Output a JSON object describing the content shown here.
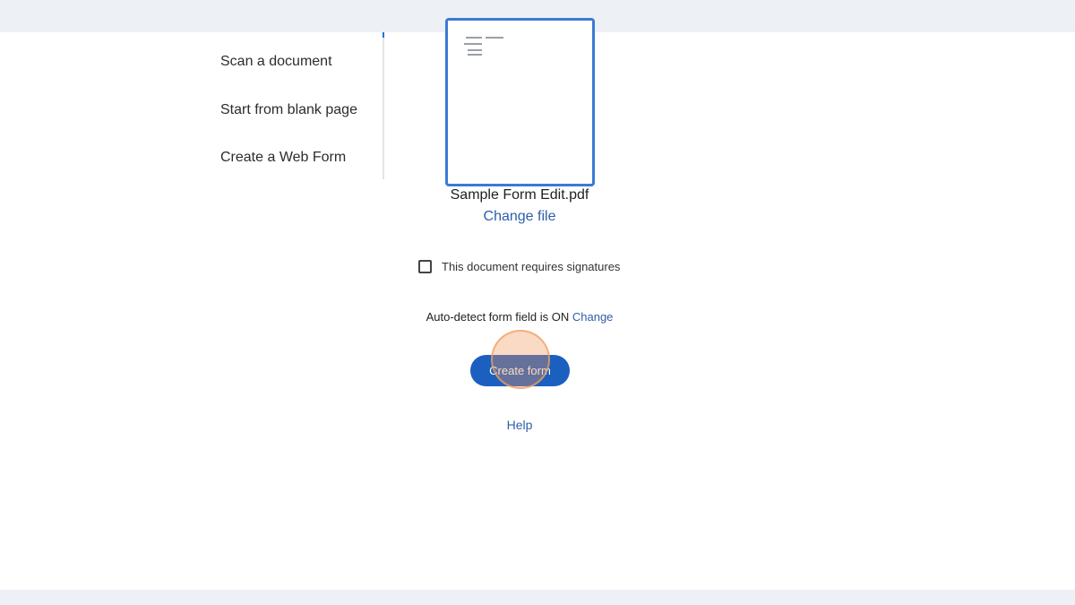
{
  "sidebar": {
    "items": [
      {
        "label": "Scan a document"
      },
      {
        "label": "Start from blank page"
      },
      {
        "label": "Create a Web Form"
      }
    ]
  },
  "file": {
    "name": "Sample Form Edit.pdf",
    "change_label": "Change file"
  },
  "signatures": {
    "label": "This document requires signatures",
    "checked": false
  },
  "auto_detect": {
    "text": "Auto-detect form field is ON",
    "change_label": "Change"
  },
  "create_button": {
    "label": "Create form"
  },
  "help": {
    "label": "Help"
  },
  "colors": {
    "accent": "#1b5fbf",
    "link": "#2d5fa8",
    "thumbnail_border": "#3a7bd5",
    "click_indicator": "#f0965a"
  }
}
